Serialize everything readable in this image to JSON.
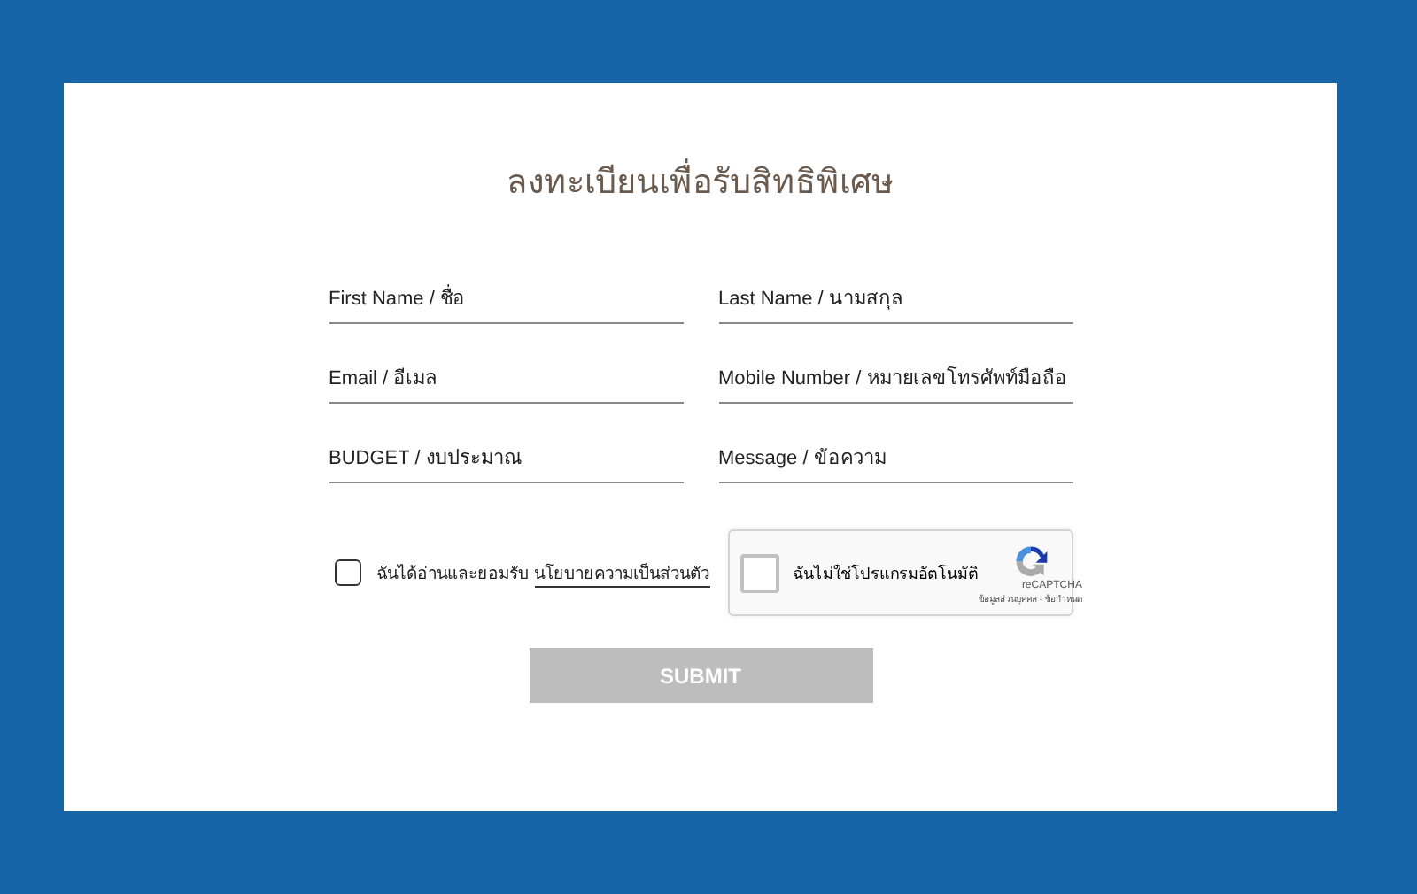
{
  "title": "ลงทะเบียนเพื่อรับสิทธิพิเศษ",
  "fields": [
    {
      "placeholder": "First Name / ชื่อ"
    },
    {
      "placeholder": "Last Name / นามสกุล"
    },
    {
      "placeholder": "Email / อีเมล"
    },
    {
      "placeholder": "Mobile Number / หมายเลขโทรศัพท์มือถือ"
    },
    {
      "placeholder": "BUDGET / งบประมาณ"
    },
    {
      "placeholder": "Message / ข้อความ"
    }
  ],
  "consent": {
    "checked": false,
    "text": "ฉันได้อ่านและยอมรับ",
    "link": "นโยบายความเป็นส่วนตัว"
  },
  "captcha": {
    "checked": false,
    "label": "ฉันไม่ใช่โปรแกรมอัตโนมัติ",
    "brand": "reCAPTCHA",
    "footer": "ข้อมูลส่วนบุคคล - ข้อกำหนด"
  },
  "submit": {
    "label": "SUBMIT",
    "disabled": true
  }
}
